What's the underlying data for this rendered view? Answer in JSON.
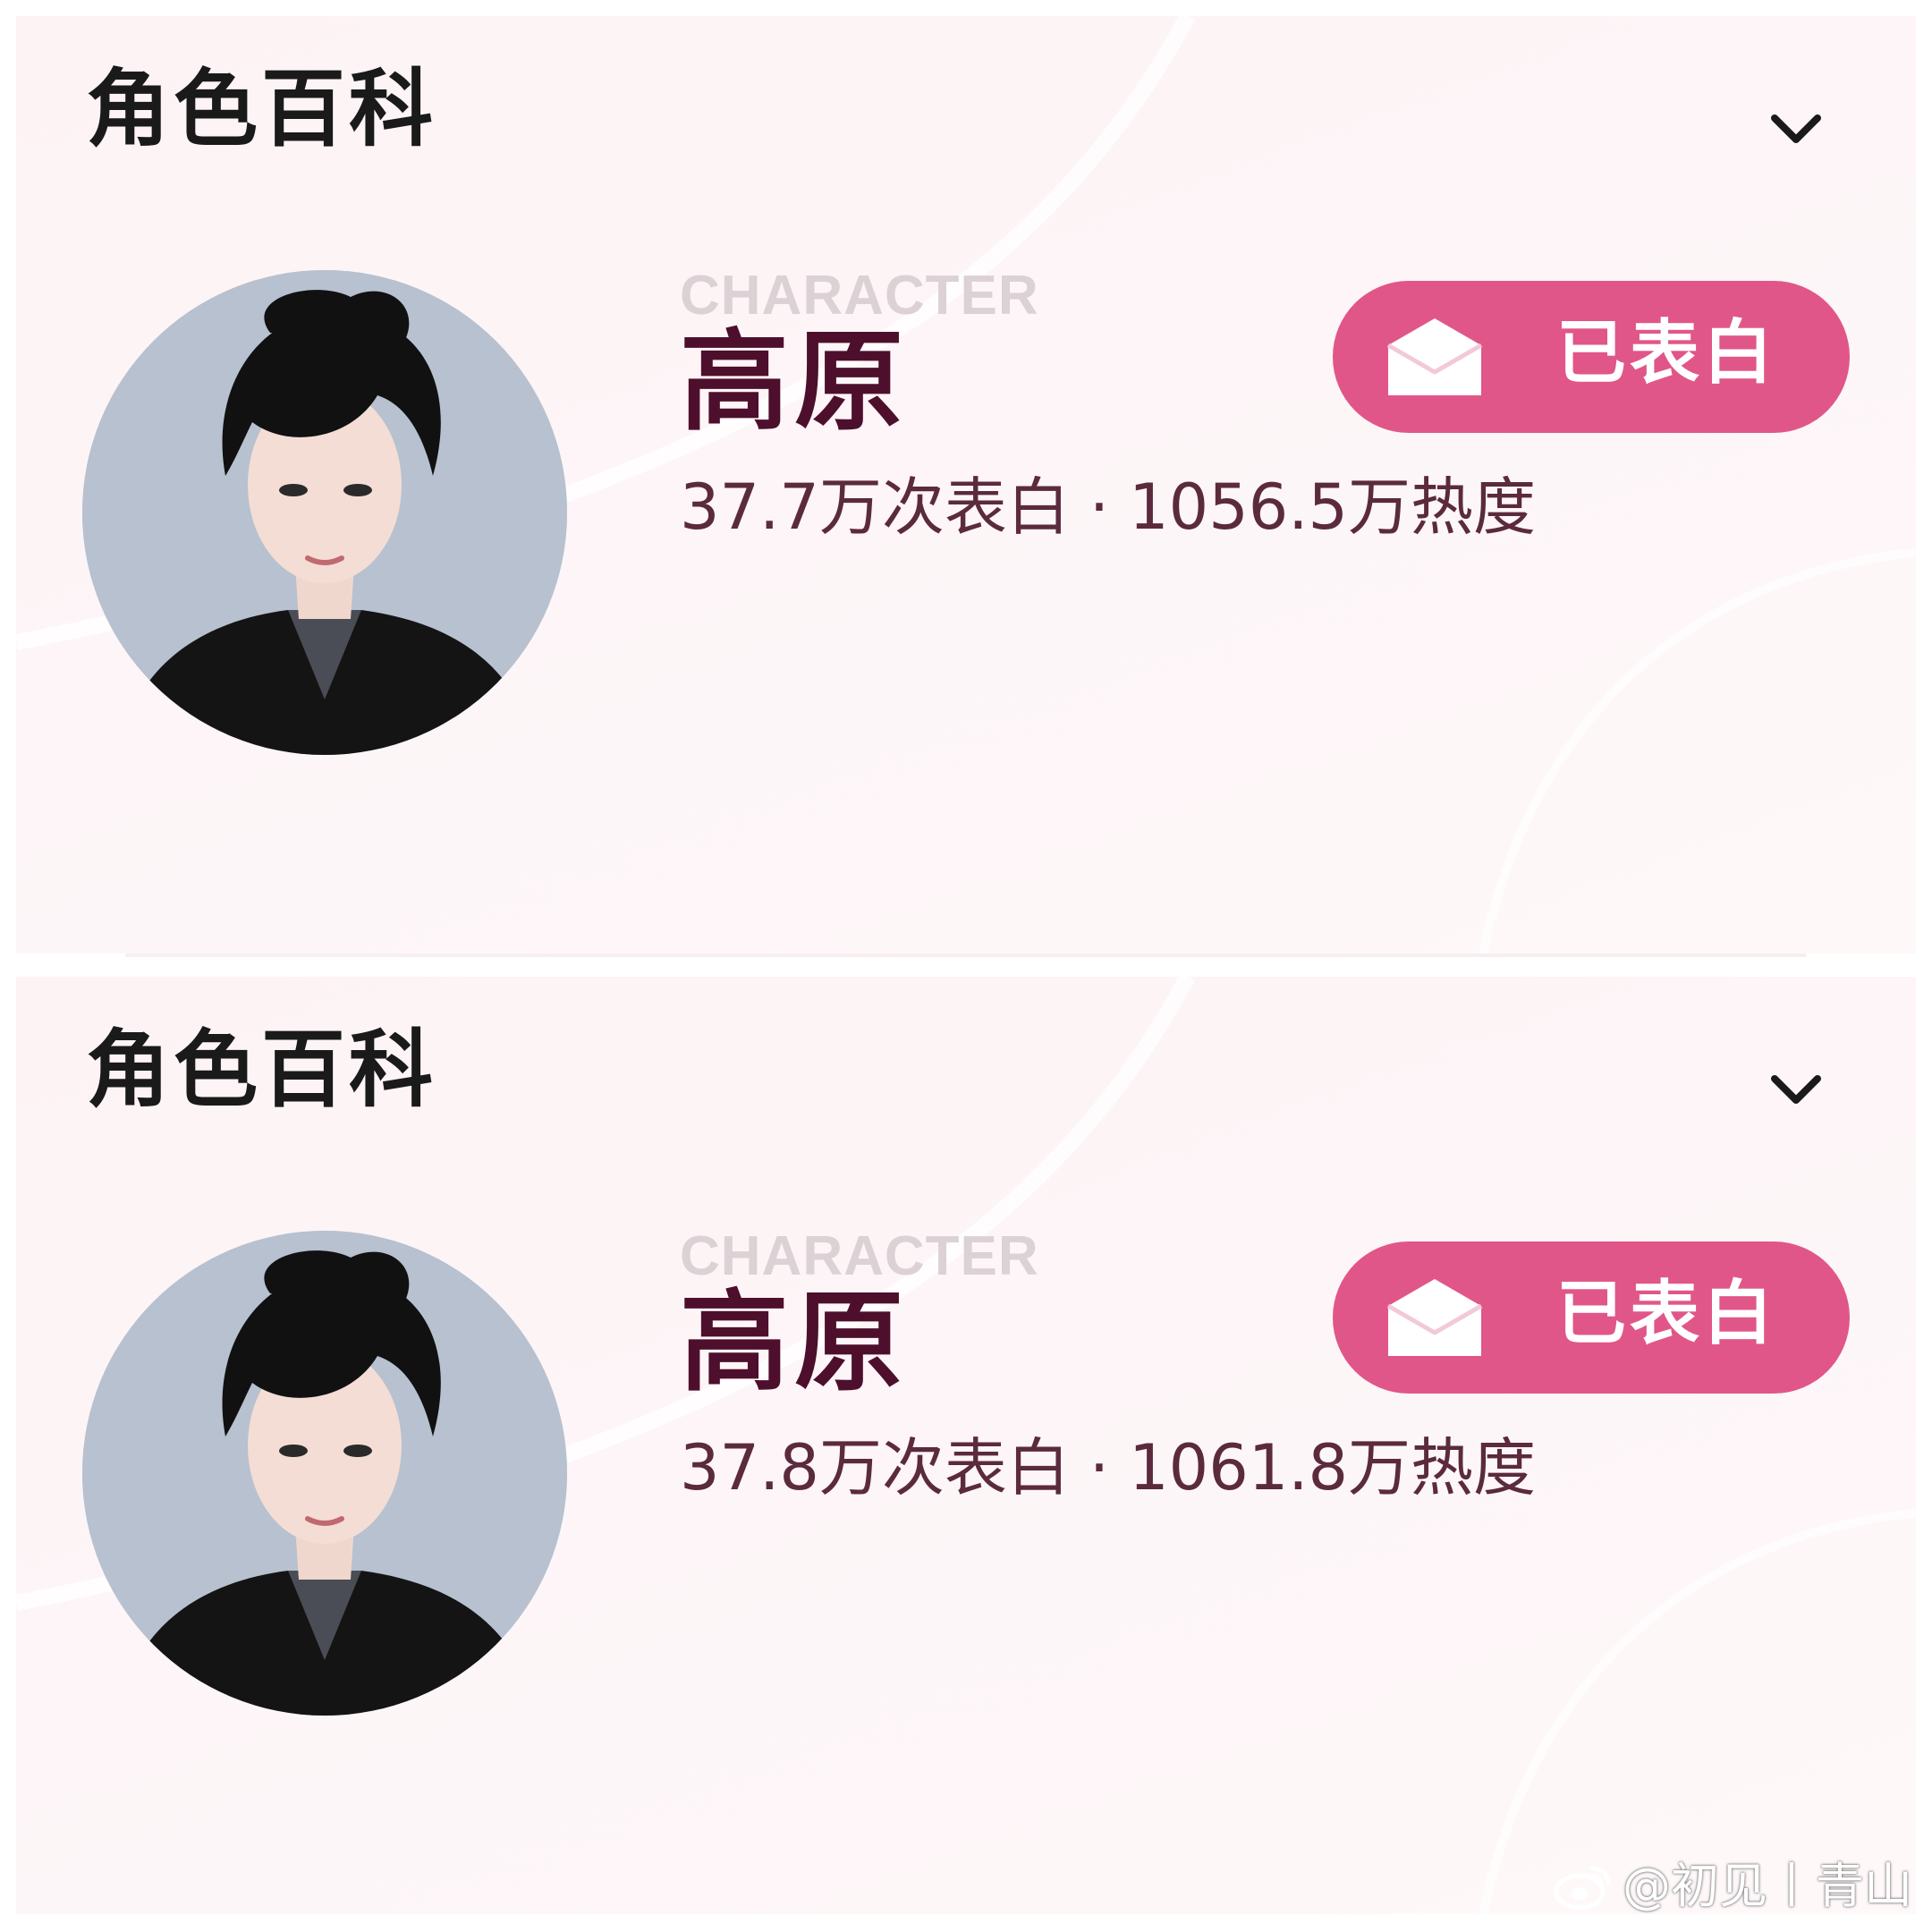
{
  "cards": [
    {
      "section_title": "角色百科",
      "character_tag": "CHARACTER",
      "name": "高原",
      "confessions": "37.7万次表白",
      "separator": "·",
      "heat": "1056.5万热度",
      "button_label": "已表白"
    },
    {
      "section_title": "角色百科",
      "character_tag": "CHARACTER",
      "name": "高原",
      "confessions": "37.8万次表白",
      "separator": "·",
      "heat": "1061.8万热度",
      "button_label": "已表白"
    }
  ],
  "watermark": {
    "text": "@初见丨青山",
    "icon": "weibo-logo-icon"
  },
  "icons": {
    "expand": "chevron-down-icon",
    "button": "envelope-icon"
  },
  "colors": {
    "button_pink": "#e15688",
    "name_maroon": "#4d0f2c",
    "card_background": "#fdf3f5"
  }
}
